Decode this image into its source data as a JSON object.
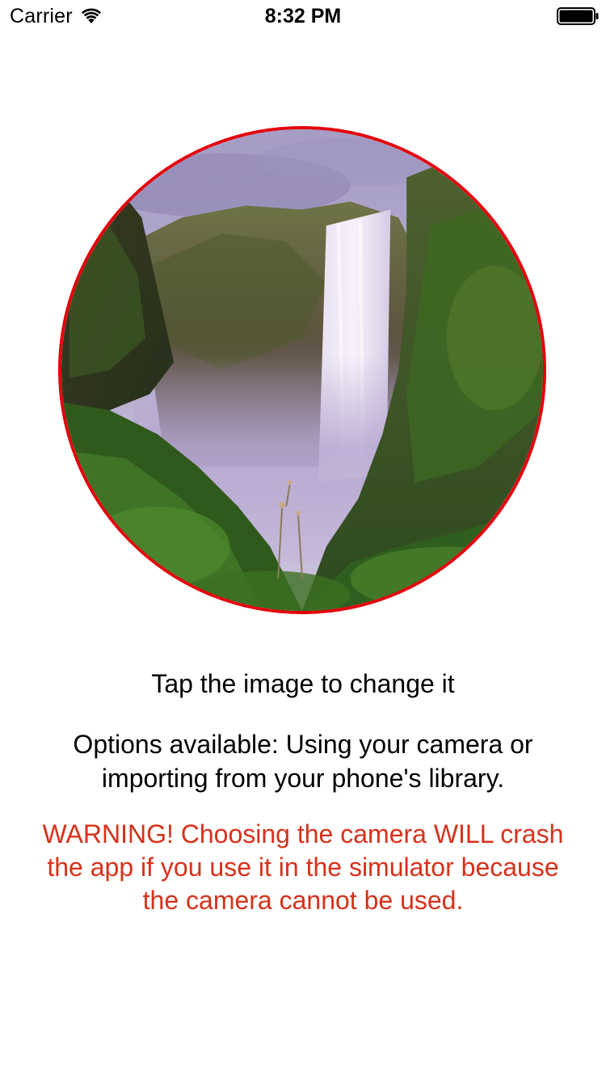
{
  "status_bar": {
    "carrier": "Carrier",
    "time": "8:32 PM",
    "wifi_icon": "wifi-icon",
    "battery_icon": "battery-full-icon"
  },
  "photo": {
    "alt": "Waterfall image",
    "border_color": "#e3000b",
    "subject": "waterfall-landscape"
  },
  "content": {
    "tap_hint": "Tap the image to change it",
    "options_line1": "Options available: Using your camera or",
    "options_line2": "importing from your phone's library.",
    "warning_line1": "WARNING! Choosing the camera WILL crash",
    "warning_line2": "the app if you use it in the simulator because",
    "warning_line3": "the camera cannot be used.",
    "warning_color": "#d6311b"
  }
}
